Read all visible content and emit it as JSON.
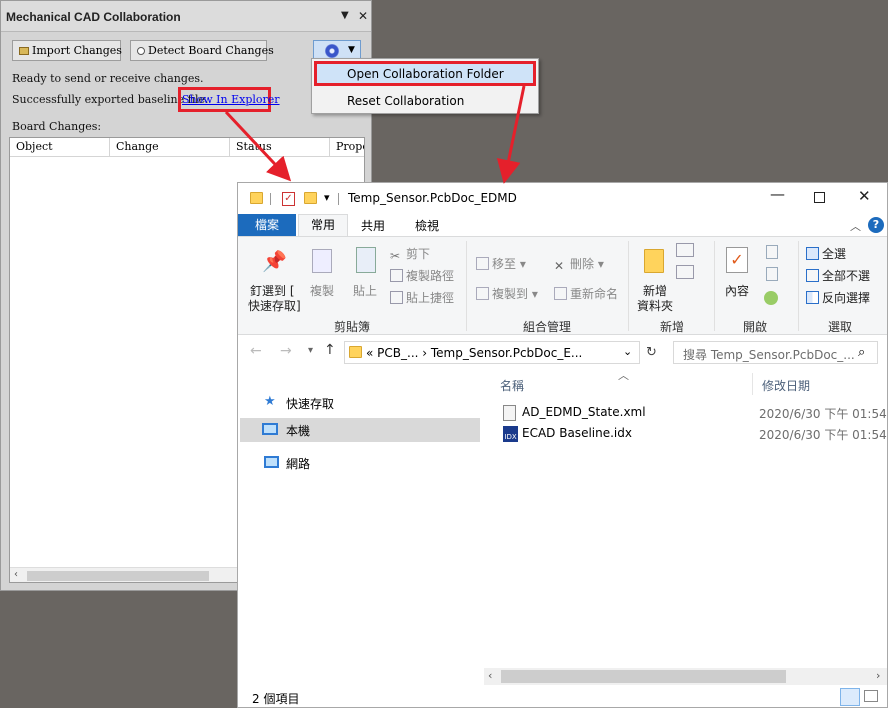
{
  "panel": {
    "title": "Mechanical CAD Collaboration",
    "pin_icon": "▼",
    "close_icon": "✕",
    "import_label": "Import Changes",
    "detect_label": "Detect Board Changes",
    "status_line": "Ready to send or receive changes.",
    "exported_text": "Successfully exported baseline file.",
    "show_link": "Show In Explorer",
    "board_changes_label": "Board Changes:",
    "columns": [
      "Object",
      "Change",
      "Status",
      "Propo"
    ]
  },
  "menu": {
    "items": [
      "Open Collaboration Folder",
      "Reset Collaboration"
    ]
  },
  "explorer": {
    "title": "Temp_Sensor.PcbDoc_EDMD",
    "qat_caret": "▾",
    "tabs": [
      "檔案",
      "常用",
      "共用",
      "檢視"
    ],
    "ribbon": {
      "pin_label_1": "釘選到 [",
      "pin_label_2": "快速存取]",
      "copy": "複製",
      "paste": "貼上",
      "cut": "剪下",
      "copy_path": "複製路徑",
      "paste_shortcut": "貼上捷徑",
      "move_to": "移至",
      "copy_to": "複製到",
      "delete": "刪除",
      "rename": "重新命名",
      "new_folder_1": "新增",
      "new_folder_2": "資料夾",
      "properties": "內容",
      "select_all": "全選",
      "select_none": "全部不選",
      "invert": "反向選擇",
      "groups": [
        "剪貼簿",
        "組合管理",
        "新增",
        "開啟",
        "選取"
      ]
    },
    "address": "«  PCB_...  ›  Temp_Sensor.PcbDoc_E...",
    "search_placeholder": "搜尋 Temp_Sensor.PcbDoc_...",
    "nav": [
      "快速存取",
      "本機",
      "網路"
    ],
    "file_columns": {
      "name": "名稱",
      "date": "修改日期"
    },
    "files": [
      {
        "name": "AD_EDMD_State.xml",
        "date": "2020/6/30 下午 01:54",
        "icon": "xml-file-icon"
      },
      {
        "name": "ECAD Baseline.idx",
        "date": "2020/6/30 下午 01:54",
        "icon": "idx-file-icon"
      }
    ],
    "status": "2 個項目"
  },
  "colors": {
    "highlight": "#e5202b",
    "file_tab": "#1c6bbd",
    "link": "#0000ee"
  }
}
